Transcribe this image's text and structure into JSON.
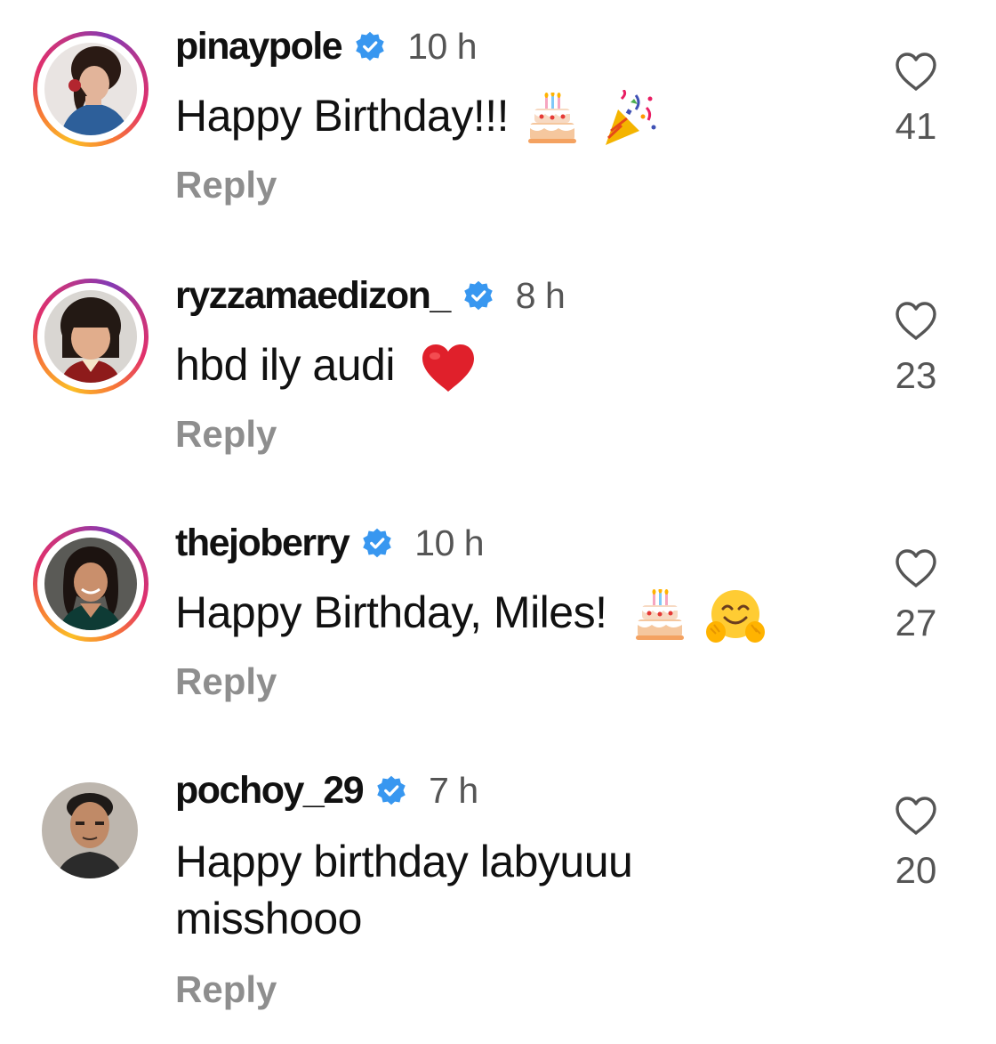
{
  "comments": [
    {
      "username": "pinaypole",
      "verified": true,
      "time": "10 h",
      "text": "Happy Birthday!!!",
      "emojis": [
        "birthday-cake",
        "party-popper"
      ],
      "reply_label": "Reply",
      "likes": "41",
      "story_ring": true
    },
    {
      "username": "ryzzamaedizon_",
      "verified": true,
      "time": "8 h",
      "text": "hbd ily audi",
      "emojis": [
        "red-heart"
      ],
      "reply_label": "Reply",
      "likes": "23",
      "story_ring": true
    },
    {
      "username": "thejoberry",
      "verified": true,
      "time": "10 h",
      "text": "Happy Birthday, Miles!",
      "emojis": [
        "birthday-cake",
        "hugging-face"
      ],
      "reply_label": "Reply",
      "likes": "27",
      "story_ring": true
    },
    {
      "username": "pochoy_29",
      "verified": true,
      "time": "7 h",
      "text": "Happy birthday labyuuu misshooo",
      "emojis": [],
      "reply_label": "Reply",
      "likes": "20",
      "story_ring": false
    }
  ],
  "colors": {
    "verified_blue": "#3897f0",
    "muted_text": "#8e8e8e",
    "time_text": "#555555",
    "heart_outline": "#555555"
  }
}
